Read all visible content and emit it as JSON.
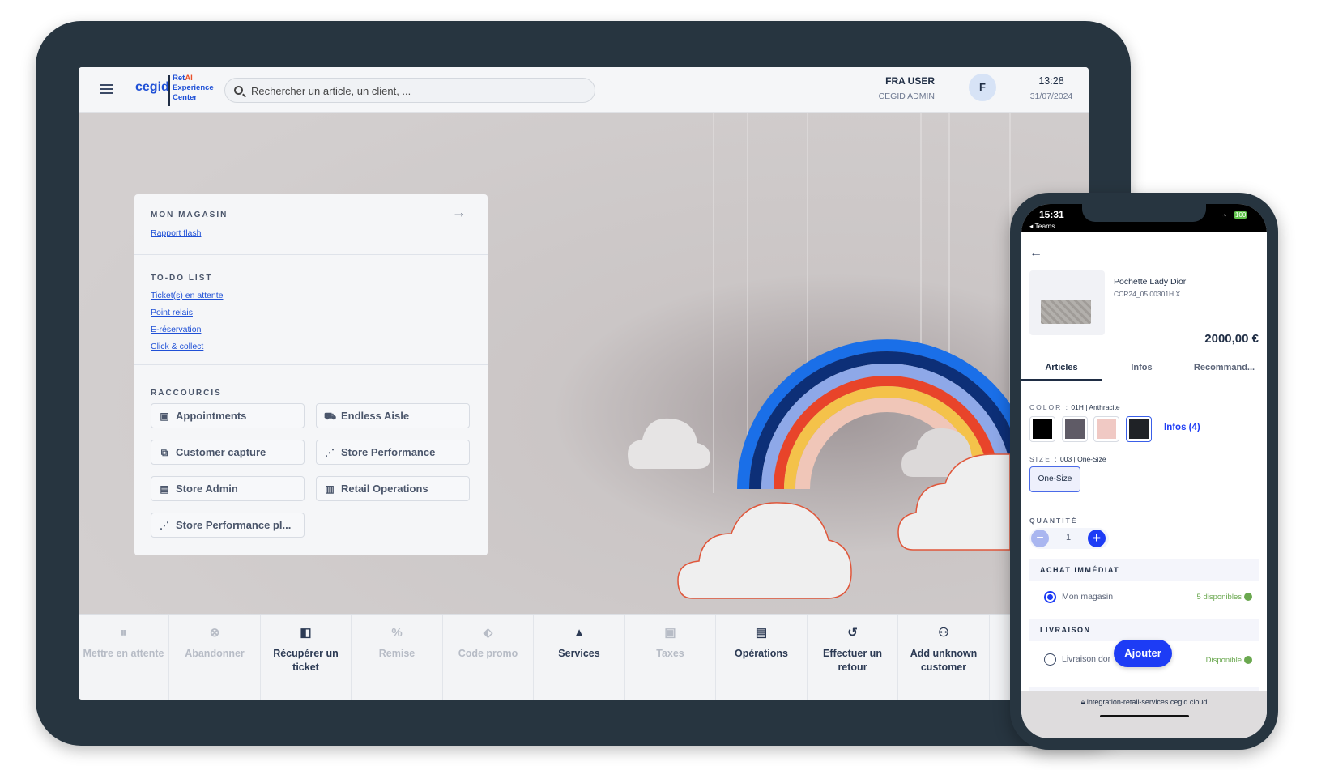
{
  "header": {
    "brand": "cegid",
    "brand_sub": [
      "Ret",
      "AI",
      "Experience",
      "Center"
    ],
    "search_placeholder": "Rechercher un article, un client, ...",
    "user_name": "FRA USER",
    "user_role": "CEGID ADMIN",
    "avatar_initial": "F",
    "time": "13:28",
    "date": "31/07/2024"
  },
  "panel": {
    "mon_magasin": {
      "title": "MON MAGASIN",
      "link": "Rapport flash"
    },
    "todo": {
      "title": "TO-DO LIST",
      "links": [
        "Ticket(s) en attente",
        "Point relais",
        "E-réservation",
        "Click & collect"
      ]
    },
    "raccourcis": {
      "title": "RACCOURCIS",
      "items": [
        {
          "label": "Appointments",
          "icon": "calendar-icon"
        },
        {
          "label": "Endless Aisle",
          "icon": "cart-icon"
        },
        {
          "label": "Customer capture",
          "icon": "external-link-icon"
        },
        {
          "label": "Store Performance",
          "icon": "chart-line-icon"
        },
        {
          "label": "Store Admin",
          "icon": "store-icon"
        },
        {
          "label": "Retail Operations",
          "icon": "document-check-icon"
        },
        {
          "label": "Store Performance pl...",
          "icon": "chart-line-icon"
        }
      ]
    }
  },
  "toolbar": [
    {
      "label": "Mettre en attente",
      "icon": "pause-icon",
      "enabled": false
    },
    {
      "label": "Abandonner",
      "icon": "cancel-icon",
      "enabled": false
    },
    {
      "label": "Récupérer un ticket",
      "icon": "retrieve-ticket-icon",
      "enabled": true
    },
    {
      "label": "Remise",
      "icon": "discount-icon",
      "enabled": false
    },
    {
      "label": "Code promo",
      "icon": "tag-icon",
      "enabled": false
    },
    {
      "label": "Services",
      "icon": "bell-icon",
      "enabled": true
    },
    {
      "label": "Taxes",
      "icon": "briefcase-icon",
      "enabled": false
    },
    {
      "label": "Opérations",
      "icon": "terminal-icon",
      "enabled": true
    },
    {
      "label": "Effectuer un retour",
      "icon": "undo-icon",
      "enabled": true
    },
    {
      "label": "Add unknown customer",
      "icon": "add-user-icon",
      "enabled": true
    }
  ],
  "phone": {
    "status_time": "15:31",
    "back_app": "◂ Teams",
    "battery": "100",
    "product_name": "Pochette Lady Dior",
    "product_ref": "CCR24_05 00301H X",
    "price": "2000,00 €",
    "tabs": [
      "Articles",
      "Infos",
      "Recommand..."
    ],
    "color_label": "COLOR :",
    "color_value": "01H | Anthracite",
    "swatches": [
      "#000000",
      "#5f5b66",
      "#f0c9c4",
      "#1f2226"
    ],
    "infos_link": "Infos (4)",
    "size_label": "SIZE :",
    "size_value": "003 | One-Size",
    "size_option": "One-Size",
    "qty_label": "QUANTITÉ",
    "qty": "1",
    "achat_title": "ACHAT IMMÉDIAT",
    "store_option": "Mon magasin",
    "store_stock": "5 disponibles",
    "livraison_title": "LIVRAISON",
    "delivery_option": "Livraison dor",
    "delivery_stock": "Disponible",
    "add_button": "Ajouter",
    "url": "integration-retail-services.cegid.cloud"
  },
  "colors": {
    "accent": "#1d3cf5",
    "link": "#1f50d6",
    "frame": "#273540"
  }
}
